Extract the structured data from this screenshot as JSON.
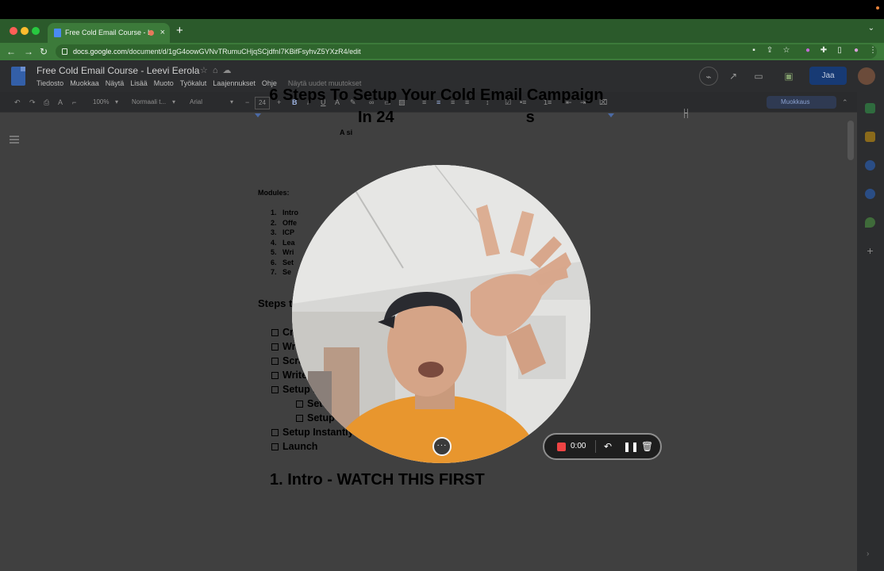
{
  "browser": {
    "tab_title": "Free Cold Email Course - L",
    "tab_close": "×",
    "new_tab": "+",
    "url_host": "docs.google.com",
    "url_path": "/document/d/1gG4oowGVNvTRumuCHjqSCjdfnI7KBifFsyhvZ5YXzR4/edit"
  },
  "docs": {
    "title": "Free Cold Email Course - Leevi Eerola",
    "menu": [
      "Tiedosto",
      "Muokkaa",
      "Näytä",
      "Lisää",
      "Muoto",
      "Työkalut",
      "Laajennukset",
      "Ohje"
    ],
    "changes_link": "Näytä uudet muutokset",
    "share_label": "Jaa",
    "toolbar": {
      "zoom": "100%",
      "style": "Normaali t...",
      "font": "Arial",
      "font_size": "24",
      "mode": "Muokkaus"
    }
  },
  "document": {
    "title_line1": "6 Steps To Setup Your Cold Email Campaign",
    "title_line2": "In 24",
    "title_line2_end": "s",
    "subtitle": "A si",
    "modules_label": "Modules:",
    "modules": [
      {
        "num": "1.",
        "text": "Intro"
      },
      {
        "num": "2.",
        "text": "Offe"
      },
      {
        "num": "3.",
        "text": "ICP"
      },
      {
        "num": "4.",
        "text": "Lea"
      },
      {
        "num": "5.",
        "text": "Wri"
      },
      {
        "num": "6.",
        "text": "Set"
      },
      {
        "num": "7.",
        "text": "Se"
      }
    ],
    "steps_label": "Steps to",
    "steps": [
      {
        "text": "Create",
        "sub": false
      },
      {
        "text": "Write do",
        "sub": false
      },
      {
        "text": "Scrape 100",
        "sub": false
      },
      {
        "text": "Write 10 differe",
        "sub": false
      },
      {
        "text": "Setup Inboxes",
        "sub": false
      },
      {
        "text": "Setup warmup",
        "sub": true
      },
      {
        "text": "Setup custom tracking domain",
        "sub": true
      },
      {
        "text": "Setup Instantly",
        "sub": false
      },
      {
        "text": "Launch",
        "sub": false
      }
    ],
    "heading2": "1.  Intro - WATCH THIS FIRST"
  },
  "recorder": {
    "time": "0:00",
    "more_label": "···"
  },
  "colors": {
    "chrome_green": "#3c7a3a",
    "record_red": "#ef4444",
    "share_blue": "#173a74"
  }
}
